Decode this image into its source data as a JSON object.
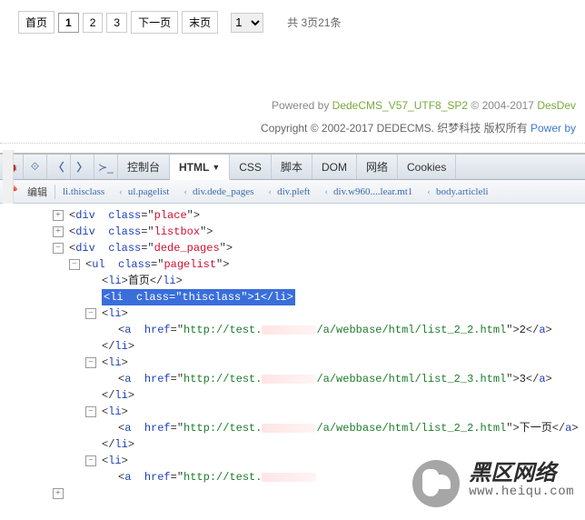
{
  "pagination": {
    "first": "首页",
    "p1": "1",
    "p2": "2",
    "p3": "3",
    "next": "下一页",
    "last": "末页",
    "select_value": "1",
    "info": "共 3页21条"
  },
  "footer": {
    "powered": "Powered by ",
    "cms": "DedeCMS_V57_UTF8_SP2",
    "copyyear1": " © 2004-2017 ",
    "desdev": "DesDev",
    "copyline": "Copyright © 2002-2017 DEDECMS. 织梦科技 版权所有 ",
    "powerby": "Power by "
  },
  "devtools": {
    "tabs": {
      "console": "控制台",
      "html": "HTML",
      "css": "CSS",
      "script": "脚本",
      "dom": "DOM",
      "net": "网络",
      "cookies": "Cookies"
    },
    "edit": "编辑",
    "breadcrumb": {
      "b1": "li.thisclass",
      "b2": "ul.pagelist",
      "b3": "div.dede_pages",
      "b4": "div.pleft",
      "b5": "div.w960....lear.mt1",
      "b6": "body.articleli"
    }
  },
  "tree": {
    "n1": {
      "tag": "div",
      "cls": "place"
    },
    "n2": {
      "tag": "div",
      "cls": "listbox"
    },
    "n3": {
      "tag": "div",
      "cls": "dede_pages"
    },
    "n4": {
      "tag": "ul",
      "cls": "pagelist"
    },
    "n5": {
      "tag": "li",
      "text": "首页",
      "close": "li"
    },
    "sel": {
      "open": "<li  class=\"thisclass\">1</li>"
    },
    "n7": {
      "tag": "li"
    },
    "n8": {
      "tag": "a",
      "href1": "http://test.",
      "href2": "/a/webbase/html/list_2_2.html",
      "text": "2",
      "aclose": "a"
    },
    "n9": {
      "close": "li"
    },
    "n10": {
      "tag": "li"
    },
    "n11": {
      "tag": "a",
      "href1": "http://test.",
      "href2": "/a/webbase/html/list_2_3.html",
      "text": "3",
      "aclose": "a"
    },
    "n12": {
      "close": "li"
    },
    "n13": {
      "tag": "li"
    },
    "n14": {
      "tag": "a",
      "href1": "http://test.",
      "href2": "/a/webbase/html/list_2_2.html",
      "text": "下一页",
      "aclose": "a"
    },
    "n15": {
      "close": "li"
    },
    "n16": {
      "tag": "li"
    },
    "n17": {
      "tag": "a",
      "href1": "http://test."
    }
  },
  "watermark": {
    "t1": "黑区网络",
    "t2": "www.heiqu.com"
  }
}
